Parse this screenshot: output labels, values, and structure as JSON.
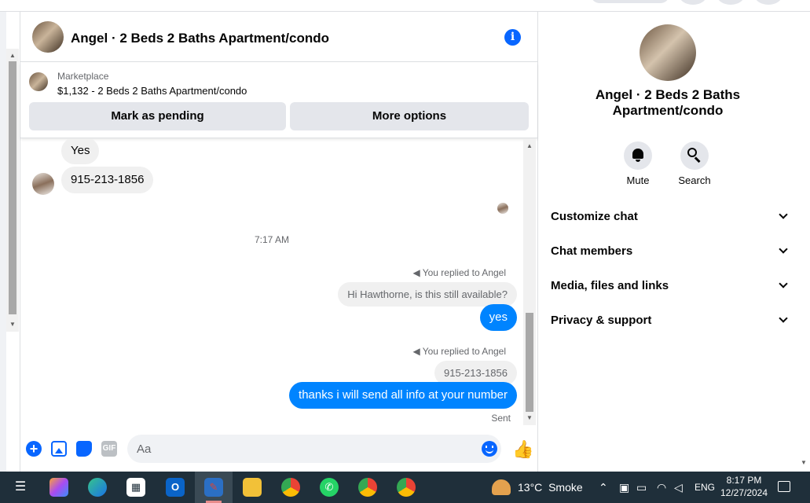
{
  "chat": {
    "title": "Angel · 2 Beds 2 Baths Apartment/condo",
    "marketplace_label": "Marketplace",
    "listing": "$1,132 - 2 Beds 2 Baths Apartment/condo",
    "mark_pending_label": "Mark as pending",
    "more_options_label": "More options"
  },
  "messages": {
    "in_1": "Yes",
    "in_2": "915-213-1856",
    "timestamp": "7:17 AM",
    "reply_1_label": "You replied to Angel",
    "reply_1_quote": "Hi Hawthorne, is this still available?",
    "out_1": "yes",
    "reply_2_label": "You replied to Angel",
    "reply_2_quote": "915-213-1856",
    "out_2": "thanks i will send all info at your number",
    "status": "Sent"
  },
  "composer": {
    "placeholder": "Aa",
    "gif_label": "GIF"
  },
  "details": {
    "title": "Angel · 2 Beds 2 Baths Apartment/condo",
    "mute_label": "Mute",
    "search_label": "Search",
    "rows": [
      "Customize chat",
      "Chat members",
      "Media, files and links",
      "Privacy & support"
    ]
  },
  "taskbar": {
    "temperature": "13°C",
    "weather": "Smoke",
    "language": "ENG",
    "time": "8:17 PM",
    "date": "12/27/2024"
  },
  "colors": {
    "accent": "#0866ff",
    "outgoing_bubble": "#0084ff",
    "incoming_bubble": "#f0f0f0",
    "taskbar": "#1f2f3a"
  }
}
